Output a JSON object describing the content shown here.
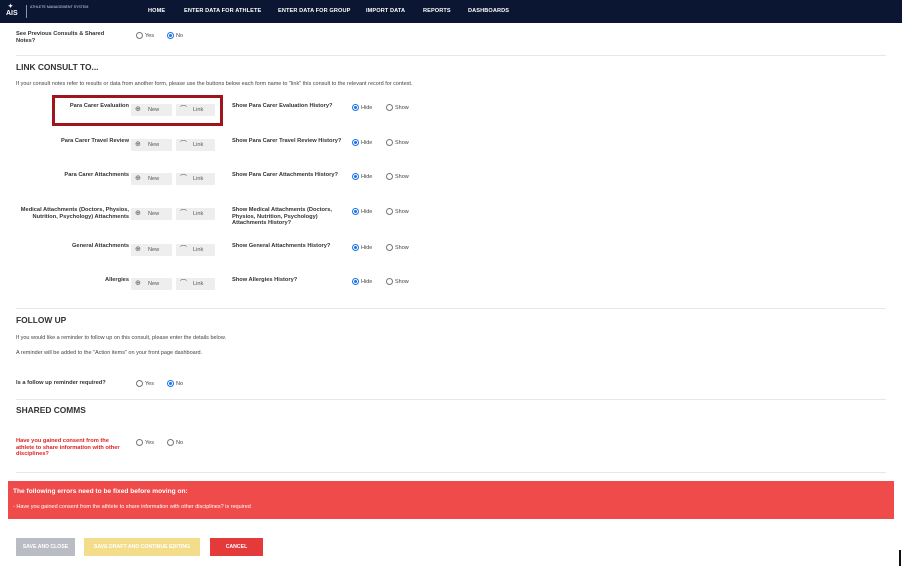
{
  "logo": {
    "mark": "AIS",
    "text": "ATHLETE MANAGEMENT SYSTEM"
  },
  "nav": [
    "HOME",
    "ENTER DATA FOR ATHLETE",
    "ENTER DATA FOR GROUP",
    "IMPORT DATA",
    "REPORTS",
    "DASHBOARDS"
  ],
  "see_previous": {
    "label": "See Previous Consults & Shared Notes?",
    "yes": "Yes",
    "no": "No",
    "selected": "No"
  },
  "link_consult": {
    "heading": "LINK CONSULT TO...",
    "intro": "If your consult notes refer to results or data from another form, please use the buttons below each form name to \"link\" this consult to the relevant record for context.",
    "new_label": "New",
    "link_label": "Link",
    "hide_label": "Hide",
    "show_label": "Show",
    "rows": [
      {
        "form": "Para Carer Evaluation",
        "history": "Show Para Carer Evaluation History?",
        "selected": "Hide"
      },
      {
        "form": "Para Carer Travel Review",
        "history": "Show Para Carer Travel Review History?",
        "selected": "Hide"
      },
      {
        "form": "Para Carer Attachments",
        "history": "Show Para Carer Attachments History?",
        "selected": "Hide"
      },
      {
        "form": "Medical Attachments (Doctors, Physios, Nutrition, Psychology) Attachments",
        "history": "Show Medical Attachments (Doctors, Physios, Nutrition, Psychology) Attachments History?",
        "selected": "Hide"
      },
      {
        "form": "General Attachments",
        "history": "Show General Attachments History?",
        "selected": "Hide"
      },
      {
        "form": "Allergies",
        "history": "Show Allergies History?",
        "selected": "Hide"
      }
    ]
  },
  "follow_up": {
    "heading": "FOLLOW UP",
    "line1": "If you would like a reminder to follow up on this consult, please enter the details below.",
    "line2": "A reminder will be added to the \"Action items\" on your front page dashboard.",
    "question": "Is a follow up reminder required?",
    "yes": "Yes",
    "no": "No",
    "selected": "No"
  },
  "shared_comms": {
    "heading": "SHARED COMMS",
    "question": "Have you gained consent from the athlete to share information with other disciplines?",
    "yes": "Yes",
    "no": "No",
    "selected": ""
  },
  "errors": {
    "title": "The following errors need to be fixed before moving on:",
    "items": [
      "- Have you gained consent from the athlete to share information with other disciplines? is required"
    ]
  },
  "actions": {
    "save_close": "SAVE AND CLOSE",
    "save_draft": "SAVE DRAFT AND CONTINUE EDITING",
    "cancel": "CANCEL"
  },
  "colors": {
    "topbar": "#0b1633",
    "error_bg": "#ef4b4b",
    "save_close_bg": "#b9bcc2",
    "save_draft_bg": "#f3dc8a",
    "cancel_bg": "#e53a3a",
    "radio_selected": "#1a73e8",
    "highlight_border": "#a0151b"
  }
}
